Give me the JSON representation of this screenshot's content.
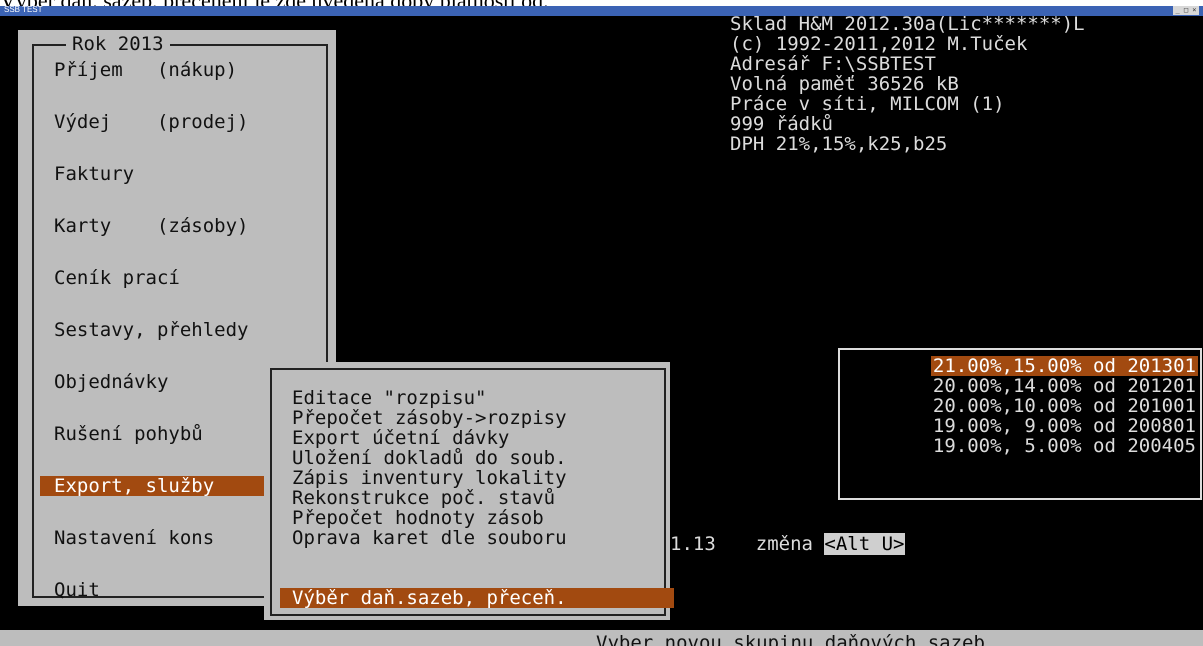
{
  "caption": "Výběr daň. sazeb, přecenění je zde uvedena doby platnosti od.",
  "window": {
    "title": "SSB TEST",
    "controls": "_ □ ×"
  },
  "main_menu": {
    "title": "Rok 2013",
    "items": [
      "Příjem   (nákup)",
      "Výdej    (prodej)",
      "Faktury",
      "Karty    (zásoby)",
      "Ceník prací",
      "Sestavy, přehledy",
      "Objednávky",
      "Rušení pohybů",
      "Export, služby",
      "Nastavení kons",
      "Quit"
    ],
    "selected_index": 8
  },
  "sub_menu": {
    "items": [
      "Editace \"rozpisu\"",
      "Přepočet zásoby->rozpisy",
      "Export účetní dávky",
      "Uložení dokladů do soub.",
      "Zápis inventury lokality",
      "Rekonstrukce poč. stavů",
      "Přepočet hodnoty zásob",
      "Oprava karet dle souboru",
      "Výběr daň.sazeb, přeceň."
    ],
    "selected_index": 8
  },
  "info": {
    "line1": "Sklad H&M 2012.30a(Lic*******)L",
    "line2": "(c) 1992-2011,2012 M.Tuček",
    "line3": "Adresář F:\\SSBTEST",
    "line4": "Volná paměť 36526 kB",
    "line5": "Práce v síti, MILCOM (1)",
    "line6": "999 řádků",
    "line7": "DPH 21%,15%,k25,b25"
  },
  "rates": {
    "items": [
      "21.00%,15.00% od 201301",
      "20.00%,14.00% od 201201",
      "20.00%,10.00% od 201001",
      "19.00%, 9.00% od 200801",
      "19.00%, 5.00% od 200405"
    ],
    "selected_index": 0
  },
  "hint": {
    "date": "1.13",
    "change": "změna",
    "key": "<Alt U>"
  },
  "status": {
    "text": "Vyber novou skupinu daňových sazeb"
  },
  "colors": {
    "highlight": "#a24a10",
    "panel": "#bdbdbd",
    "background": "#000000"
  }
}
